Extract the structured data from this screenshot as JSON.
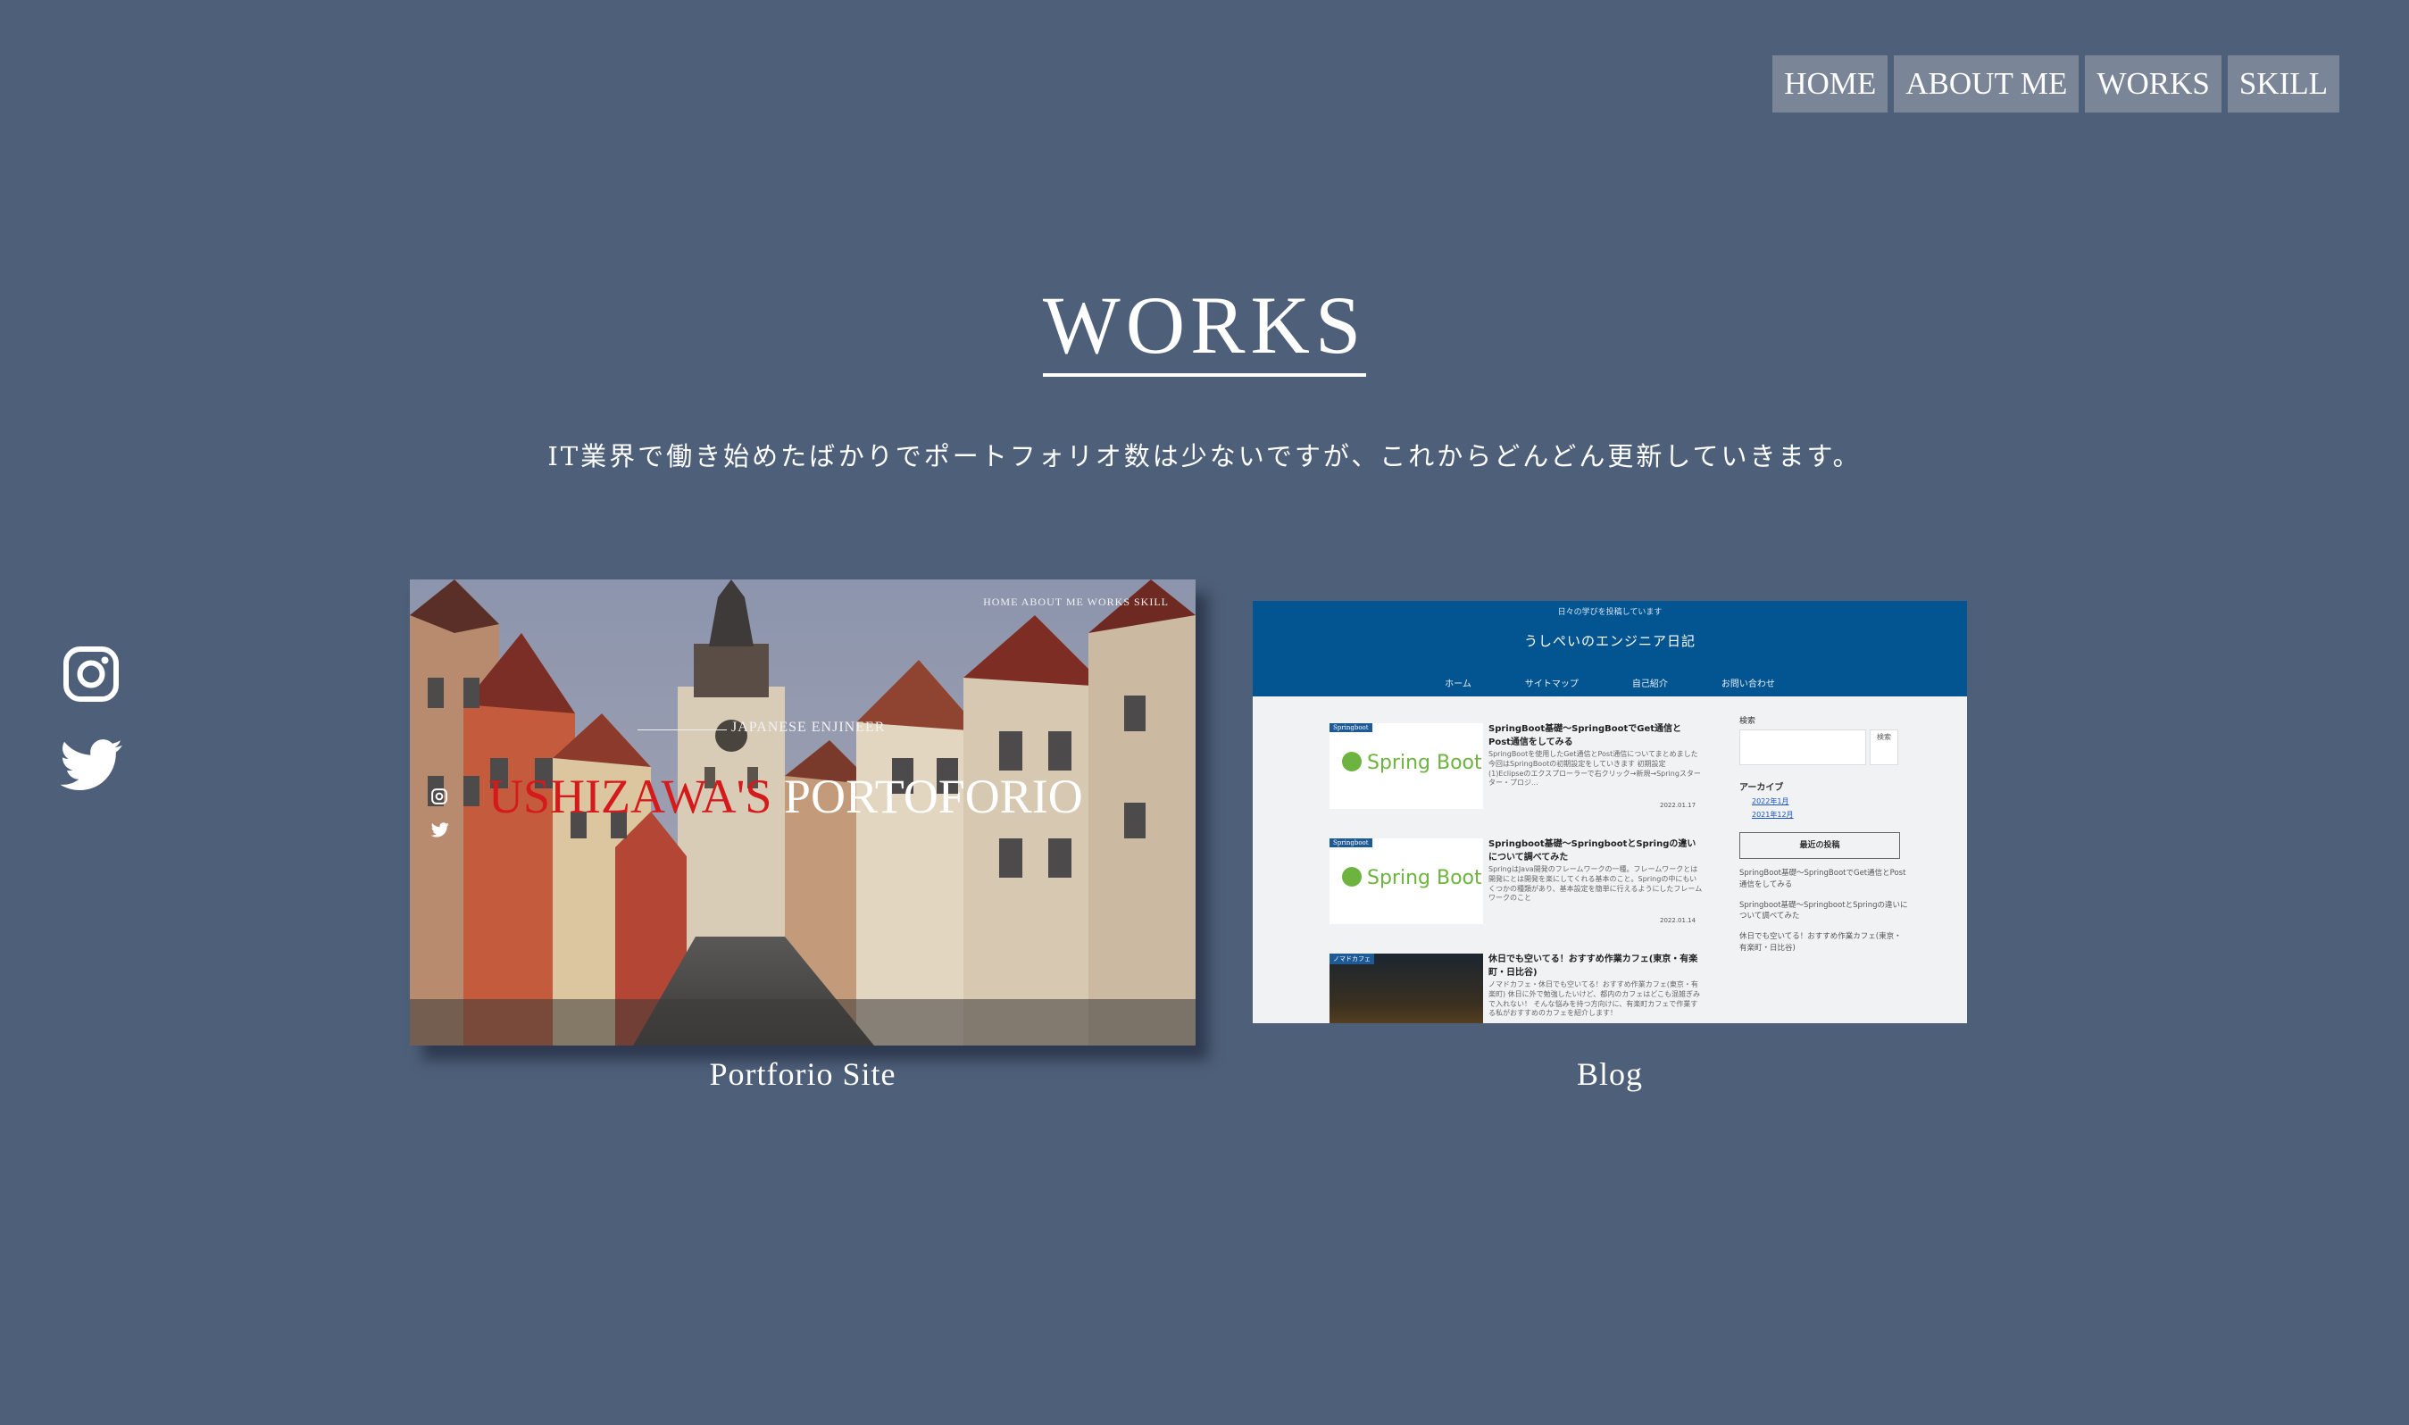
{
  "nav": {
    "items": [
      {
        "label": "HOME"
      },
      {
        "label": "ABOUT ME"
      },
      {
        "label": "WORKS"
      },
      {
        "label": "SKILL"
      }
    ]
  },
  "social": {
    "icons": [
      "instagram-icon",
      "twitter-icon"
    ]
  },
  "section": {
    "title": "WORKS",
    "lead": "IT業界で働き始めたばかりでポートフォリオ数は少ないですが、これからどんどん更新していきます。"
  },
  "works": [
    {
      "caption": "Portforio Site",
      "thumb": {
        "nav": "HOME   ABOUT ME   WORKS   SKILL",
        "subtitle": "JAPANESE ENJINEER",
        "title_red": "USHIZAWA'S",
        "title_white": "PORTOFORIO"
      }
    },
    {
      "caption": "Blog",
      "thumb": {
        "tagline": "日々の学びを投稿しています",
        "site_title": "うしぺいのエンジニア日記",
        "nav": [
          "ホーム",
          "サイトマップ",
          "自己紹介",
          "お問い合わせ"
        ],
        "posts": [
          {
            "badge": "Springboot",
            "logo": "Spring Boot",
            "title": "SpringBoot基礎〜SpringBootでGet通信とPost通信をしてみる",
            "excerpt": "SpringBootを使用したGet通信とPost通信についてまとめました 今回はSpringBootの初期設定をしていきます 初期設定 (1)Eclipseのエクスプローラーで右クリック→新規→Springスターター・プロジ...",
            "date": "2022.01.17"
          },
          {
            "badge": "Springboot",
            "logo": "Spring Boot",
            "title": "Springboot基礎〜SpringbootとSpringの違いについて調べてみた",
            "excerpt": "SpringはJava開発のフレームワークの一種。フレームワークとは開発にとは開発を楽にしてくれる基本のこと。Springの中にもいくつかの種類があり、基本設定を簡単に行えるようにしたフレームワークのこと",
            "date": "2022.01.14"
          },
          {
            "badge": "ノマドカフェ",
            "title": "休日でも空いてる！おすすめ作業カフェ(東京・有楽町・日比谷)",
            "excerpt": "ノマドカフェ・休日でも空いてる！おすすめ作業カフェ(東京・有楽町) 休日に外で勉強したいけど、都内のカフェはどこも混雑ぎみで入れない！ そんな悩みを持つ方向けに、有楽町カフェで作業する私がおすすめのカフェを紹介します！"
          }
        ],
        "sidebar": {
          "search_label": "検索",
          "search_button": "検索",
          "archive_label": "アーカイブ",
          "archives": [
            "2022年1月",
            "2021年12月"
          ],
          "recent_label": "最近の投稿",
          "recent": [
            "SpringBoot基礎〜SpringBootでGet通信とPost通信をしてみる",
            "Springboot基礎〜SpringbootとSpringの違いについて調べてみた",
            "休日でも空いてる！おすすめ作業カフェ(東京・有楽町・日比谷)"
          ]
        }
      }
    }
  ]
}
